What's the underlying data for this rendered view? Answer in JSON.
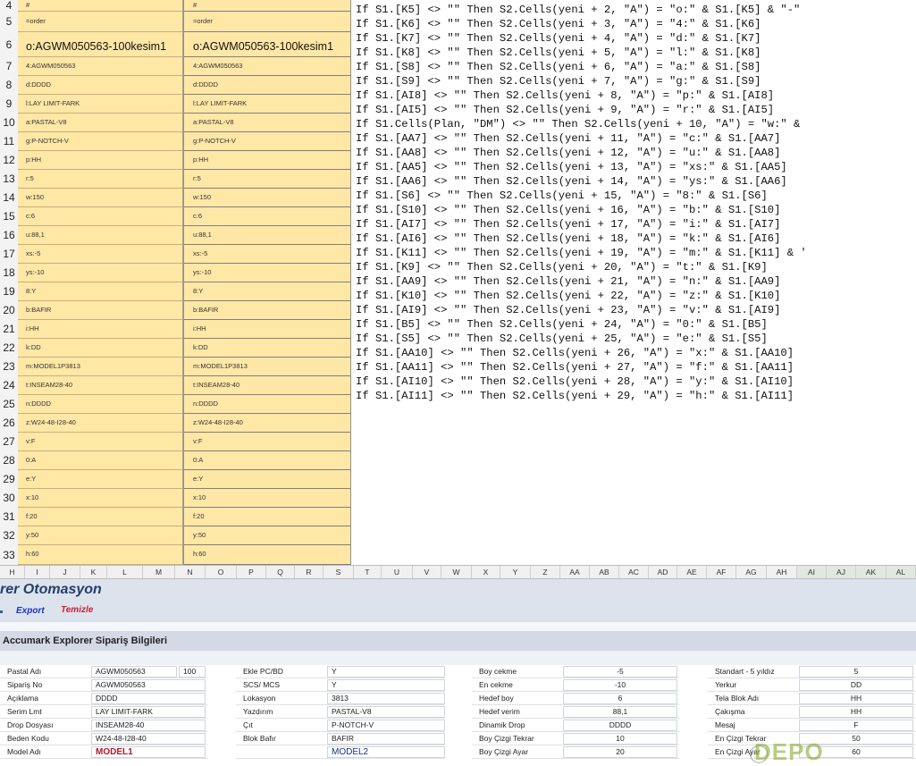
{
  "sheet": {
    "row_numbers": [
      "4",
      "5",
      "6",
      "7",
      "8",
      "9",
      "10",
      "11",
      "12",
      "13",
      "14",
      "15",
      "16",
      "17",
      "18",
      "19",
      "20",
      "21",
      "22",
      "23",
      "24",
      "25",
      "26",
      "27",
      "28",
      "29",
      "30",
      "31",
      "32",
      "33"
    ],
    "col_a": [
      "#",
      "=order",
      "o:AGWM050563-100kesim1",
      "4:AGWM050563",
      "d:DDDD",
      "l:LAY LIMIT-FARK",
      "a:PASTAL-V8",
      "g:P-NOTCH-V",
      "p:HH",
      "r:5",
      "w:150",
      "c:6",
      "u:88,1",
      "xs:-5",
      "ys:-10",
      "8:Y",
      "b:BAFIR",
      "i:HH",
      "k:DD",
      "m:MODEL1P3813",
      "t:INSEAM28-40",
      "n:DDDD",
      "z:W24-48-I28-40",
      "v:F",
      "0:A",
      "e:Y",
      "x:10",
      "f:20",
      "y:50",
      "h:60"
    ],
    "col_b": [
      "#",
      "=order",
      "o:AGWM050563-100kesim1",
      "4:AGWM050563",
      "d:DDDD",
      "l:LAY LIMIT-FARK",
      "a:PASTAL-V8",
      "g:P-NOTCH-V",
      "p:HH",
      "r:5",
      "w:150",
      "c:6",
      "u:88,1",
      "xs:-5",
      "ys:-10",
      "8:Y",
      "b:BAFIR",
      "i:HH",
      "k:DD",
      "m:MODEL1P3813",
      "t:INSEAM28-40",
      "n:DDDD",
      "z:W24-48-I28-40",
      "v:F",
      "0:A",
      "e:Y",
      "x:10",
      "f:20",
      "y:50",
      "h:60"
    ],
    "code_lines": [
      "If S1.[K5] <> \"\" Then S2.Cells(yeni + 2, \"A\") = \"o:\" & S1.[K5] & \"-\"",
      "If S1.[K6] <> \"\" Then S2.Cells(yeni + 3, \"A\") = \"4:\" & S1.[K6]",
      "If S1.[K7] <> \"\" Then S2.Cells(yeni + 4, \"A\") = \"d:\" & S1.[K7]",
      "If S1.[K8] <> \"\" Then S2.Cells(yeni + 5, \"A\") = \"l:\" & S1.[K8]",
      "If S1.[S8] <> \"\" Then S2.Cells(yeni + 6, \"A\") = \"a:\" & S1.[S8]",
      "If S1.[S9] <> \"\" Then S2.Cells(yeni + 7, \"A\") = \"g:\" & S1.[S9]",
      "If S1.[AI8] <> \"\" Then S2.Cells(yeni + 8, \"A\") = \"p:\" & S1.[AI8]",
      "If S1.[AI5] <> \"\" Then S2.Cells(yeni + 9, \"A\") = \"r:\" & S1.[AI5]",
      "If S1.Cells(Plan, \"DM\") <> \"\" Then S2.Cells(yeni + 10, \"A\") = \"w:\" &",
      "If S1.[AA7] <> \"\" Then S2.Cells(yeni + 11, \"A\") = \"c:\" & S1.[AA7]",
      "If S1.[AA8] <> \"\" Then S2.Cells(yeni + 12, \"A\") = \"u:\" & S1.[AA8]",
      "If S1.[AA5] <> \"\" Then S2.Cells(yeni + 13, \"A\") = \"xs:\" & S1.[AA5]",
      "If S1.[AA6] <> \"\" Then S2.Cells(yeni + 14, \"A\") = \"ys:\" & S1.[AA6]",
      "If S1.[S6] <> \"\" Then S2.Cells(yeni + 15, \"A\") = \"8:\" & S1.[S6]",
      "If S1.[S10] <> \"\" Then S2.Cells(yeni + 16, \"A\") = \"b:\" & S1.[S10]",
      "If S1.[AI7] <> \"\" Then S2.Cells(yeni + 17, \"A\") = \"i:\" & S1.[AI7]",
      "If S1.[AI6] <> \"\" Then S2.Cells(yeni + 18, \"A\") = \"k:\" & S1.[AI6]",
      "If S1.[K11] <> \"\" Then S2.Cells(yeni + 19, \"A\") = \"m:\" & S1.[K11] & '",
      "If S1.[K9] <> \"\" Then S2.Cells(yeni + 20, \"A\") = \"t:\" & S1.[K9]",
      "If S1.[AA9] <> \"\" Then S2.Cells(yeni + 21, \"A\") = \"n:\" & S1.[AA9]",
      "If S1.[K10] <> \"\" Then S2.Cells(yeni + 22, \"A\") = \"z:\" & S1.[K10]",
      "If S1.[AI9] <> \"\" Then S2.Cells(yeni + 23, \"A\") = \"v:\" & S1.[AI9]",
      "If S1.[B5] <> \"\" Then S2.Cells(yeni + 24, \"A\") = \"0:\" & S1.[B5]",
      "If S1.[S5] <> \"\" Then S2.Cells(yeni + 25, \"A\") = \"e:\" & S1.[S5]",
      "If S1.[AA10] <> \"\" Then S2.Cells(yeni + 26, \"A\") = \"x:\" & S1.[AA10]",
      "If S1.[AA11] <> \"\" Then S2.Cells(yeni + 27, \"A\") = \"f:\" & S1.[AA11]",
      "If S1.[AI10] <> \"\" Then S2.Cells(yeni + 28, \"A\") = \"y:\" & S1.[AI10]",
      "If S1.[AI11] <> \"\" Then S2.Cells(yeni + 29, \"A\") = \"h:\" & S1.[AI11]"
    ],
    "column_headers": [
      "H",
      "I",
      "J",
      "K",
      "L",
      "M",
      "N",
      "O",
      "P",
      "Q",
      "R",
      "S",
      "T",
      "U",
      "V",
      "W",
      "X",
      "Y",
      "Z",
      "AA",
      "AB",
      "AC",
      "AD",
      "AE",
      "AF",
      "AG",
      "AH",
      "AI",
      "AJ",
      "AK",
      "AL"
    ]
  },
  "panel": {
    "app_title": "rer Otomasyon",
    "export_label": "Export",
    "clear_label": "Temizle",
    "section_title": "Accumark Explorer Sipariş Bilgileri",
    "groups": [
      {
        "rows": [
          {
            "label": "Pastal Adı",
            "value": "AGWM050563",
            "extra": "100"
          },
          {
            "label": "Sipariş No",
            "value": "AGWM050563"
          },
          {
            "label": "Açıklama",
            "value": "DDDD"
          },
          {
            "label": "Serim Lmt",
            "value": "LAY LIMIT-FARK"
          },
          {
            "label": "Drop Dosyası",
            "value": "INSEAM28-40"
          },
          {
            "label": "Beden Kodu",
            "value": "W24-48-I28-40"
          },
          {
            "label": "Model Adı",
            "value": "MODEL1"
          }
        ]
      },
      {
        "rows": [
          {
            "label": "Ekle PC/BD",
            "value": "Y"
          },
          {
            "label": "SCS/ MCS",
            "value": "Y"
          },
          {
            "label": "Lokasyon",
            "value": "3813"
          },
          {
            "label": "Yazdırım",
            "value": "PASTAL-V8"
          },
          {
            "label": "Çıt",
            "value": "P-NOTCH-V"
          },
          {
            "label": "Blok Bafır",
            "value": "BAFIR"
          },
          {
            "label": "",
            "value": "MODEL2"
          }
        ]
      },
      {
        "rows": [
          {
            "label": "Boy cekme",
            "value": "-5"
          },
          {
            "label": "En cekme",
            "value": "-10"
          },
          {
            "label": "Hedef boy",
            "value": "6"
          },
          {
            "label": "Hedef verim",
            "value": "88,1"
          },
          {
            "label": "Dinamik Drop",
            "value": "DDDD"
          },
          {
            "label": "Boy Çizgi Tekrar",
            "value": "10"
          },
          {
            "label": "Boy Çizgi Ayar",
            "value": "20"
          }
        ]
      },
      {
        "rows": [
          {
            "label": "Standart  - 5 yıldız",
            "value": "5"
          },
          {
            "label": "Yerkur",
            "value": "DD"
          },
          {
            "label": "Tela Blok Adı",
            "value": "HH"
          },
          {
            "label": "Çakışma",
            "value": "HH"
          },
          {
            "label": "Mesaj",
            "value": "F"
          },
          {
            "label": "En Çizgi Tekrar",
            "value": "50"
          },
          {
            "label": "En Çizgi Ayar",
            "value": "60"
          }
        ]
      }
    ],
    "watermark": "DEPO"
  },
  "colors": {
    "cell_fill": "#ffe7a6",
    "title": "#1f3f6e",
    "export": "#1a33c7",
    "clear": "#c8203a",
    "model_red": "#b01a2a",
    "model_blue": "#1b2f8a"
  }
}
